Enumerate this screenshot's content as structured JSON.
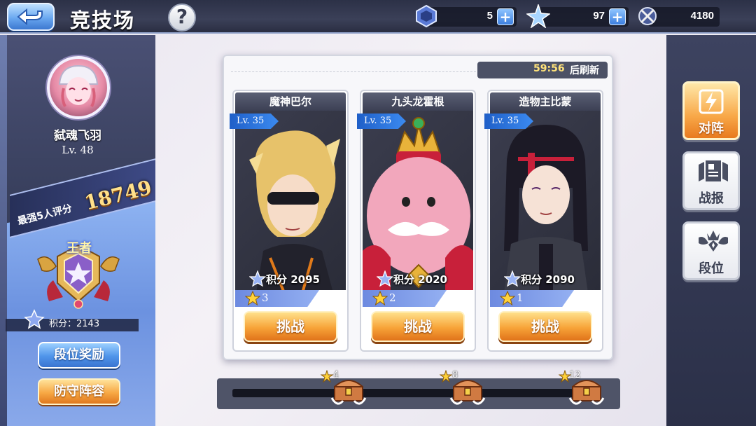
{
  "header": {
    "title": "竞技场",
    "help_label": "?"
  },
  "resources": [
    {
      "icon": "badge-token-icon",
      "value": "5"
    },
    {
      "icon": "blue-star-icon",
      "value": "97"
    },
    {
      "icon": "crossed-swords-medal-icon",
      "value": "4180"
    }
  ],
  "player": {
    "name": "弑魂飞羽",
    "level": "Lv. 48",
    "rating_label": "最强5人评分",
    "rating_value": "18749",
    "rank_title": "王者",
    "score_text": "积分：2143"
  },
  "left_buttons": {
    "rank_reward": "段位奖励",
    "defense_lineup": "防守阵容"
  },
  "refresh": {
    "time": "59:56",
    "label": "后刷新"
  },
  "opponents": [
    {
      "name": "魔神巴尔",
      "level": "Lv. 35",
      "score": "积分 2095",
      "stars": "3",
      "challenge": "挑战",
      "theme": "#e7c26a"
    },
    {
      "name": "九头龙霍根",
      "level": "Lv. 35",
      "score": "积分 2020",
      "stars": "2",
      "challenge": "挑战",
      "theme": "#e99ab4"
    },
    {
      "name": "造物主比蒙",
      "level": "Lv. 35",
      "score": "积分 2090",
      "stars": "1",
      "challenge": "挑战",
      "theme": "#2c2a38"
    }
  ],
  "side_menu": [
    {
      "label": "对阵",
      "active": true,
      "icon": "lightning-shield-icon"
    },
    {
      "label": "战报",
      "active": false,
      "icon": "report-scroll-icon"
    },
    {
      "label": "段位",
      "active": false,
      "icon": "crown-wings-icon"
    }
  ],
  "progress": {
    "milestones": [
      "4",
      "8",
      "12"
    ],
    "current_fraction": 0
  },
  "colors": {
    "accent_orange": "#f7a338",
    "accent_blue": "#4f94ea",
    "rating_gold": "#ffe08a",
    "refresh_time": "#ffe27a"
  }
}
